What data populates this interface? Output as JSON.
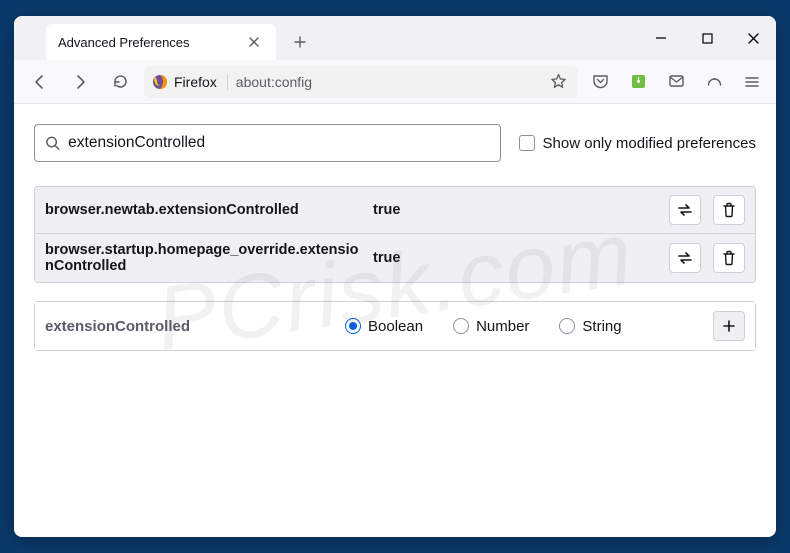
{
  "tab": {
    "title": "Advanced Preferences"
  },
  "urlbar": {
    "identity_label": "Firefox",
    "url": "about:config"
  },
  "search": {
    "value": "extensionControlled",
    "show_modified_label": "Show only modified preferences"
  },
  "prefs": [
    {
      "name": "browser.newtab.extensionControlled",
      "value": "true"
    },
    {
      "name": "browser.startup.homepage_override.extensionControlled",
      "value": "true"
    }
  ],
  "new_pref": {
    "name": "extensionControlled",
    "types": [
      "Boolean",
      "Number",
      "String"
    ],
    "selected": "Boolean"
  },
  "watermark": "PCrisk.com"
}
